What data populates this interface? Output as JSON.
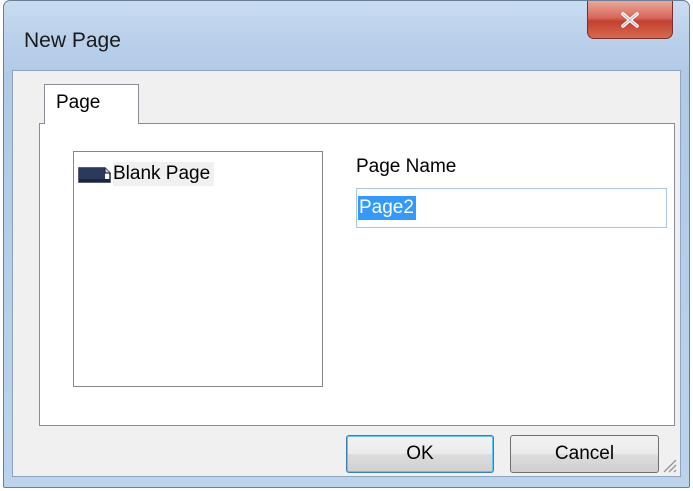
{
  "window": {
    "title": "New Page",
    "close_icon": "close-icon"
  },
  "tabs": [
    {
      "label": "Page",
      "selected": true
    }
  ],
  "template_list": {
    "items": [
      {
        "label": "Blank Page",
        "icon": "page-icon",
        "selected": true
      }
    ]
  },
  "page_name": {
    "label": "Page Name",
    "value": "Page2"
  },
  "buttons": {
    "ok": "OK",
    "cancel": "Cancel"
  },
  "colors": {
    "selection": "#3399ff",
    "close_button": "#c2412f"
  }
}
